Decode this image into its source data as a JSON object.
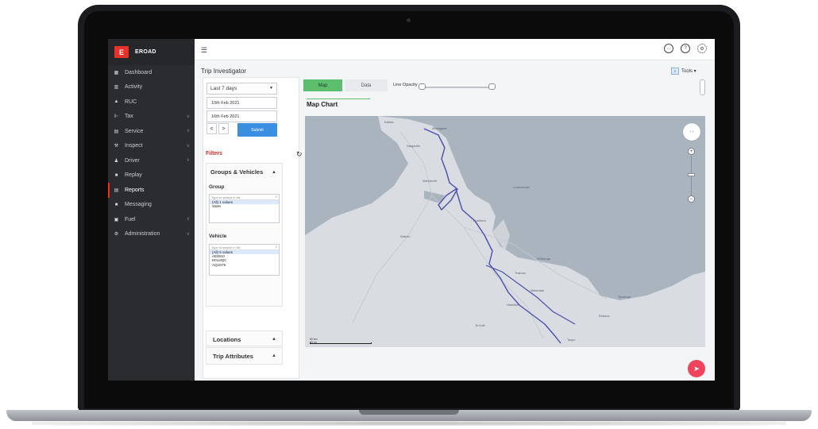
{
  "app": {
    "brand_logo": "E",
    "brand_name": "EROAD"
  },
  "sidebar": {
    "items": [
      {
        "label": "Dashboard",
        "icon": "dashboard-icon",
        "glyph": "▦",
        "chevron": false,
        "active": false
      },
      {
        "label": "Activity",
        "icon": "activity-icon",
        "glyph": "▥",
        "chevron": false,
        "active": false
      },
      {
        "label": "RUC",
        "icon": "ruc-icon",
        "glyph": "▲",
        "chevron": false,
        "active": false
      },
      {
        "label": "Tax",
        "icon": "tax-icon",
        "glyph": "⊩",
        "chevron": true,
        "active": false
      },
      {
        "label": "Service",
        "icon": "service-icon",
        "glyph": "▤",
        "chevron": true,
        "active": false
      },
      {
        "label": "Inspect",
        "icon": "inspect-icon",
        "glyph": "⚒",
        "chevron": true,
        "active": false
      },
      {
        "label": "Driver",
        "icon": "driver-icon",
        "glyph": "♟",
        "chevron": true,
        "active": false
      },
      {
        "label": "Replay",
        "icon": "replay-icon",
        "glyph": "■",
        "chevron": false,
        "active": false
      },
      {
        "label": "Reports",
        "icon": "reports-icon",
        "glyph": "▤",
        "chevron": false,
        "active": true
      },
      {
        "label": "Messaging",
        "icon": "messaging-icon",
        "glyph": "■",
        "chevron": false,
        "active": false
      },
      {
        "label": "Fuel",
        "icon": "fuel-icon",
        "glyph": "▣",
        "chevron": true,
        "active": false
      },
      {
        "label": "Administration",
        "icon": "administration-icon",
        "glyph": "⚙",
        "chevron": true,
        "active": false
      }
    ]
  },
  "topbar": {
    "icons": [
      "chat-icon",
      "help-icon",
      "settings-icon"
    ]
  },
  "page": {
    "title": "Trip Investigator",
    "tools_label": "Tools ▾"
  },
  "filters_panel": {
    "period": "Last 7 days",
    "date_from": "10th Feb 2021",
    "date_to": "16th Feb 2021",
    "prev": "<",
    "next": ">",
    "submit": "Submit",
    "filters_label": "Filters",
    "groups_title": "Groups & Vehicles",
    "group_label": "Group",
    "group_search_placeholder": "Type to search in list",
    "group_items": [
      "(All) 1 values",
      "Sales"
    ],
    "vehicle_label": "Vehicle",
    "vehicle_search_placeholder": "Type to search in list",
    "vehicle_items": [
      "(All) 5 values",
      "AE5910",
      "HGL8QC",
      "AQ1D75"
    ],
    "locations_title": "Locations",
    "trip_attributes_title": "Trip Attributes"
  },
  "map_panel": {
    "tab_map": "Map",
    "tab_data": "Data",
    "line_opacity_label": "Line Opacity",
    "chart_title": "Map Chart",
    "labels": [
      "Kaitaia",
      "Whangarei",
      "Dargaville",
      "Auckland",
      "Hamilton",
      "Tauranga",
      "Rotorua",
      "Taupo",
      "Thames",
      "Whitianga",
      "Te Kuiti",
      "Matamata",
      "Coromandel",
      "Waiuku",
      "Warkworth"
    ],
    "scale_km": "50 km",
    "scale_mi": "30 mi"
  },
  "colors": {
    "accent_red": "#e5322d",
    "tab_green": "#5cbf6e",
    "submit_blue": "#3a8fe0",
    "route": "#4a4fb0",
    "fab": "#f0445c"
  }
}
